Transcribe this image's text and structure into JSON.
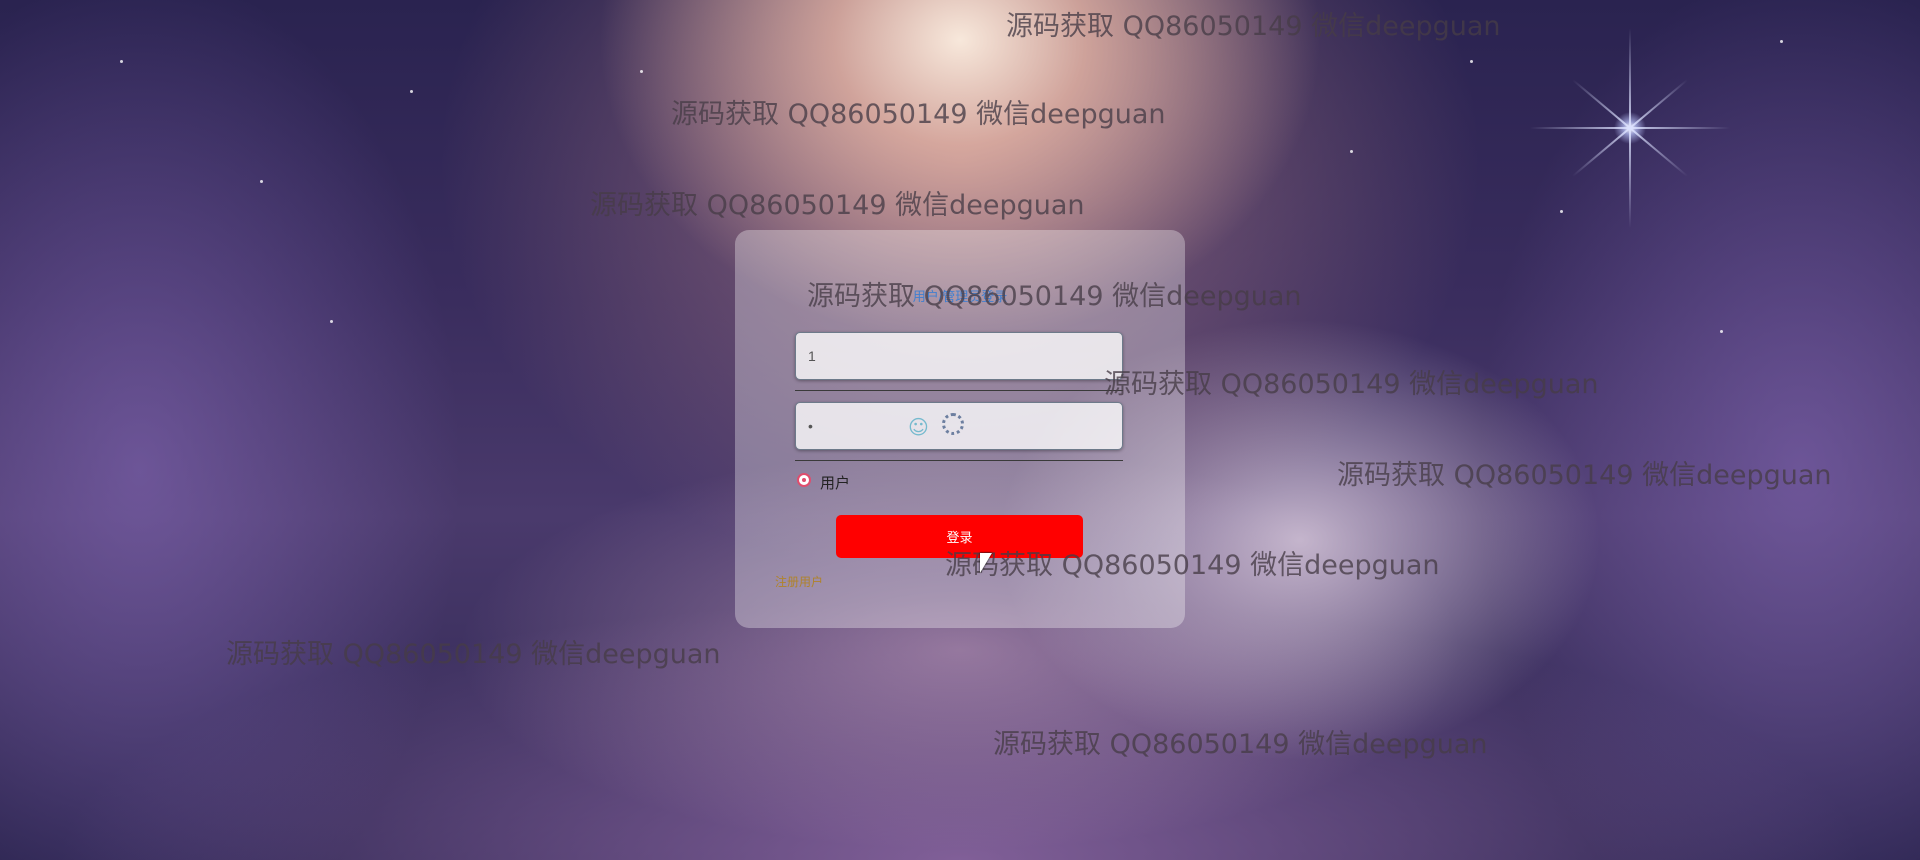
{
  "login": {
    "title": "用户/管理员登录",
    "username_value": "1",
    "password_value": "•",
    "role_label": "用户",
    "login_button": "登录",
    "register_link": "注册用户"
  },
  "watermarks": [
    "源码获取 QQ86050149 微信deepguan",
    "源码获取 QQ86050149 微信deepguan",
    "源码获取 QQ86050149 微信deepguan",
    "源码获取 QQ86050149 微信deepguan",
    "源码获取 QQ86050149 微信deepguan",
    "源码获取 QQ86050149 微信deepguan",
    "源码获取 QQ86050149 微信deepguan",
    "源码获取 QQ86050149 微信deepguan",
    "源码获取 QQ86050149 微信deepguan"
  ],
  "colors": {
    "button": "#ff0000",
    "radio_accent": "#e04d6d",
    "register_link": "#b0832a"
  }
}
